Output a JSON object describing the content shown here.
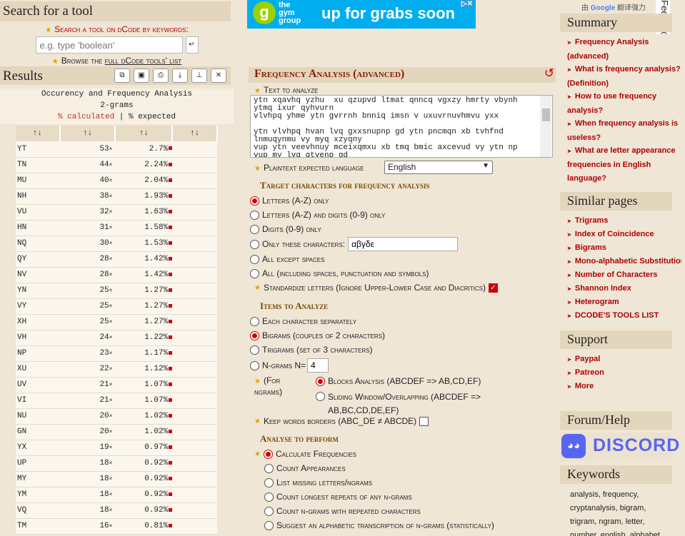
{
  "left": {
    "search_title": "Search for a tool",
    "search_label": "Search a tool on dCode by keywords:",
    "search_placeholder": "e.g. type 'boolean'",
    "browse_prefix": "Browse the ",
    "browse_link": "full dCode tools' list",
    "results_title": "Results",
    "result_header": {
      "line1": "Occurency and Frequency Analysis",
      "line2": "2-grams",
      "pct_calc": "% calculated",
      "sep": " | ",
      "pct_exp": "% expected"
    },
    "sort_icon": "↑↓",
    "rows": [
      {
        "g": "YT",
        "n": "53",
        "p": "2.7%"
      },
      {
        "g": "TN",
        "n": "44",
        "p": "2.24%"
      },
      {
        "g": "MU",
        "n": "40",
        "p": "2.04%"
      },
      {
        "g": "NH",
        "n": "38",
        "p": "1.93%"
      },
      {
        "g": "VU",
        "n": "32",
        "p": "1.63%"
      },
      {
        "g": "HN",
        "n": "31",
        "p": "1.58%"
      },
      {
        "g": "NQ",
        "n": "30",
        "p": "1.53%"
      },
      {
        "g": "QY",
        "n": "28",
        "p": "1.42%"
      },
      {
        "g": "NV",
        "n": "28",
        "p": "1.42%"
      },
      {
        "g": "YN",
        "n": "25",
        "p": "1.27%"
      },
      {
        "g": "VY",
        "n": "25",
        "p": "1.27%"
      },
      {
        "g": "XH",
        "n": "25",
        "p": "1.27%"
      },
      {
        "g": "VH",
        "n": "24",
        "p": "1.22%"
      },
      {
        "g": "NP",
        "n": "23",
        "p": "1.17%"
      },
      {
        "g": "XU",
        "n": "22",
        "p": "1.12%"
      },
      {
        "g": "UV",
        "n": "21",
        "p": "1.07%"
      },
      {
        "g": "VI",
        "n": "21",
        "p": "1.07%"
      },
      {
        "g": "NU",
        "n": "20",
        "p": "1.02%"
      },
      {
        "g": "GN",
        "n": "20",
        "p": "1.02%"
      },
      {
        "g": "YX",
        "n": "19",
        "p": "0.97%"
      },
      {
        "g": "UP",
        "n": "18",
        "p": "0.92%"
      },
      {
        "g": "MY",
        "n": "18",
        "p": "0.92%"
      },
      {
        "g": "YM",
        "n": "18",
        "p": "0.92%"
      },
      {
        "g": "VQ",
        "n": "18",
        "p": "0.92%"
      },
      {
        "g": "TM",
        "n": "16",
        "p": "0.81%"
      }
    ],
    "times_symbol": "×"
  },
  "ad": {
    "logo": "g",
    "brand": "the gym group",
    "text": "up for grabs soon"
  },
  "main": {
    "title": "Frequency Analysis (advanced)",
    "text_label": "Text to analyze",
    "text_value": "ytn xqavhq yzhu  xu qzupvd ltmat qnncq vgxzy hmrty vbynh\nytmq ixur qyhvurn\nvlvhpq yhme ytn gvrrnh bnniq imsn v uxuvrnuvhmvu yxx\n\nytn vlvhpq hvan lvq gxxsnupnp gd ytn pncmqn xb tvhfnd\nlnmuqynmu vy myq xzyqny\nvup ytn veevhnuy mceixqmxu xb tmq bmic axcevud vy ytn np\nvup my lvq qtvenp gd",
    "lang_label": "Plaintext expected language",
    "lang_value": "English",
    "target_title": "Target characters for frequency analysis",
    "target_opts": [
      "Letters (A-Z) only",
      "Letters (A-Z) and digits (0-9) only",
      "Digits (0-9) only",
      "Only these characters:",
      "All except spaces",
      "All (including spaces, punctuation and symbols)"
    ],
    "only_chars_value": "αβγδε",
    "standardize_label": "Standardize letters (Ignore Upper-Lower Case and Diacritics)",
    "items_title": "Items to Analyze",
    "item_opts": [
      "Each character separately",
      "Bigrams (couples of 2 characters)",
      "Trigrams (set of 3 characters)",
      "N-grams N="
    ],
    "n_value": "4",
    "for_ngrams": "(For\nngrams)",
    "blocks_label": "Blocks Analysis (ABCDEF => AB,CD,EF)",
    "sliding_label": "Sliding Window/Overlapping (ABCDEF =>\nAB,BC,CD,DE,EF)",
    "keep_borders_label": "Keep words borders (ABC_DE ≠ ABCDE)",
    "analyse_title": "Analyse to perform",
    "analyse_opts": [
      "Calculate Frequencies",
      "Count Appearances",
      "List missing letters/ngrams",
      "Count longest repeats of any n-grams",
      "Count n-grams with repeated characters",
      "Suggest an alphabetic transcription of n-grams (statistically)"
    ]
  },
  "right": {
    "translate_prefix": "由 ",
    "translate_google": "Google",
    "translate_suffix": " 翻译强力",
    "feedback": "Feedback",
    "summary_title": "Summary",
    "summary_links": [
      "Frequency Analysis (advanced)",
      "What is frequency analysis? (Definition)",
      "How to use frequency analysis?",
      "When frequency analysis is useless?",
      "What are letter appearance frequencies in English language?"
    ],
    "similar_title": "Similar pages",
    "similar_links": [
      "Trigrams",
      "Index of Coincidence",
      "Bigrams",
      "Mono-alphabetic Substitution",
      "Number of Characters",
      "Shannon Index",
      "Heterogram",
      "DCODE'S TOOLS LIST"
    ],
    "support_title": "Support",
    "support_links": [
      "Paypal",
      "Patreon",
      "More"
    ],
    "forum_title": "Forum/Help",
    "discord_text": "DISCORD",
    "keywords_title": "Keywords",
    "keywords_text": "analysis, frequency, cryptanalysis, bigram, trigram, ngram, letter, number, english, alphabet"
  },
  "colors": {
    "accent": "#b00000",
    "panel": "#e3d6bd",
    "background": "#efe6d6",
    "discord": "#5865f2"
  }
}
